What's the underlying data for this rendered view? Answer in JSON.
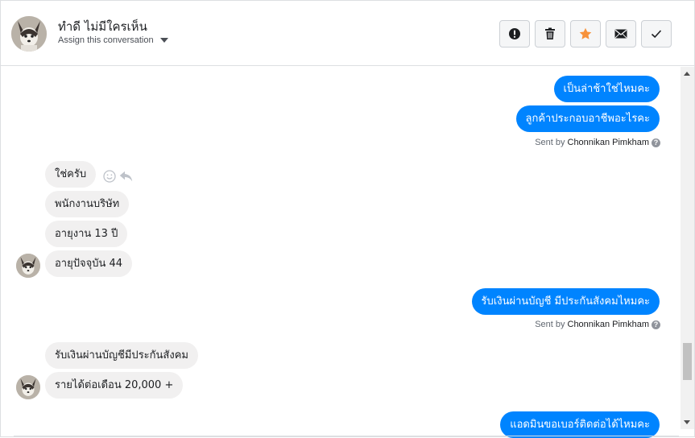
{
  "header": {
    "contact_name": "ทำดี ไม่มีใครเห็น",
    "assign_label": "Assign this conversation"
  },
  "toolbar": {
    "buttons": [
      {
        "name": "mark-spam",
        "icon": "exclamation-circle-icon"
      },
      {
        "name": "delete",
        "icon": "trash-icon"
      },
      {
        "name": "star",
        "icon": "star-icon",
        "color": "#f7923b"
      },
      {
        "name": "mark-unread",
        "icon": "envelope-icon"
      },
      {
        "name": "mark-done",
        "icon": "checkmark-icon"
      }
    ]
  },
  "messages": [
    {
      "direction": "out",
      "text": "เป็นล่าช้าใช่ไหมคะ"
    },
    {
      "direction": "out",
      "text": "ลูกค้าประกอบอาชีพอะไรคะ"
    },
    {
      "sent_by_prefix": "Sent by",
      "sent_by_name": "Chonnikan Pimkham"
    },
    {
      "direction": "in",
      "text": "ใช่ครับ"
    },
    {
      "direction": "in",
      "text": "พนักงานบริษัท"
    },
    {
      "direction": "in",
      "text": "อายุงาน 13 ปี"
    },
    {
      "direction": "in",
      "text": "อายุปัจจุบัน 44"
    },
    {
      "direction": "out",
      "text": "รับเงินผ่านบัญชี มีประกันสังคมไหมคะ"
    },
    {
      "sent_by_prefix": "Sent by",
      "sent_by_name": "Chonnikan Pimkham"
    },
    {
      "direction": "in",
      "text": "รับเงินผ่านบัญชีมีประกันสังคม"
    },
    {
      "direction": "in",
      "text": "รายได้ต่อเดือน 20,000 +"
    },
    {
      "direction": "out",
      "text": "แอดมินขอเบอร์ติดต่อได้ไหมคะ"
    }
  ],
  "colors": {
    "outgoing_bubble": "#0084ff",
    "incoming_bubble": "#f1f0f0",
    "star_accent": "#f7923b"
  }
}
